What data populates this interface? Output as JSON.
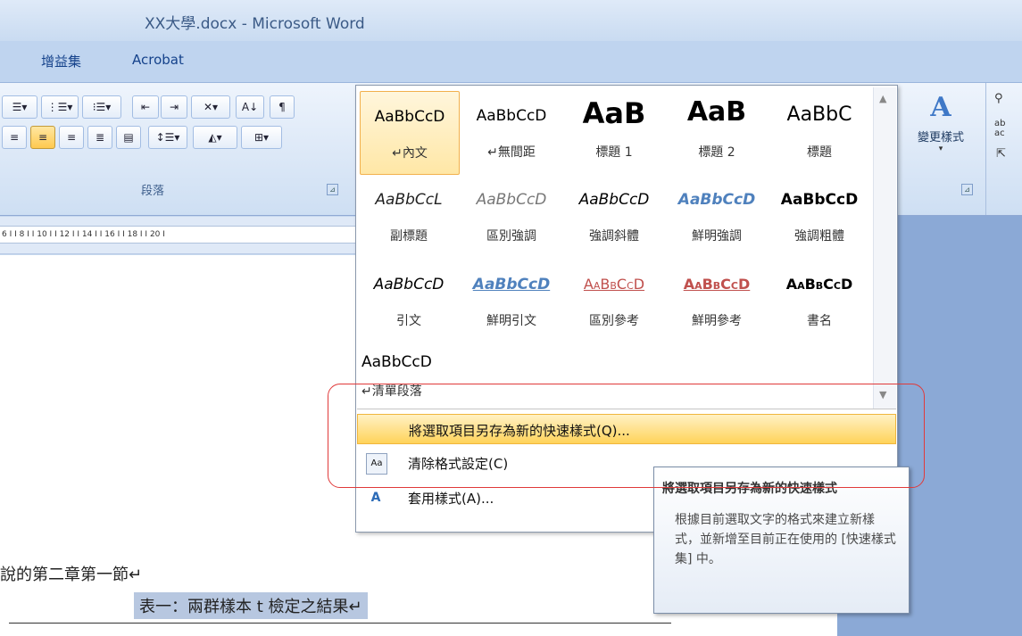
{
  "window": {
    "title": "XX大學.docx - Microsoft Word"
  },
  "tabs": [
    "增益集",
    "Acrobat"
  ],
  "ribbon": {
    "paragraph_group": {
      "label": "段落",
      "launcher": "⊿"
    },
    "styles_group": {
      "launcher": "⊿"
    },
    "change_styles": {
      "label": "變更樣式"
    },
    "editing_icons": [
      "尋找",
      "取代",
      "選取"
    ]
  },
  "ruler": {
    "text": "6 I  I 8 I  I 10 I  I 12 I  I 14 I  I 16 I  I 18 I  I 20 I"
  },
  "style_gallery": {
    "rows": [
      [
        {
          "preview": "AaBbCcD",
          "name": "↵內文",
          "selected": true
        },
        {
          "preview": "AaBbCcD",
          "name": "↵無間距"
        },
        {
          "preview": "AaB",
          "name": "標題 1"
        },
        {
          "preview": "AaB",
          "name": "標題 2"
        },
        {
          "preview": "AaBbC",
          "name": "標題"
        }
      ],
      [
        {
          "preview": "AaBbCcL",
          "name": "副標題"
        },
        {
          "preview": "AaBbCcD",
          "name": "區別強調"
        },
        {
          "preview": "AaBbCcD",
          "name": "強調斜體"
        },
        {
          "preview": "AaBbCcD",
          "name": "鮮明強調"
        },
        {
          "preview": "AaBbCcD",
          "name": "強調粗體"
        }
      ],
      [
        {
          "preview": "AaBbCcD",
          "name": "引文"
        },
        {
          "preview": "AaBbCcD",
          "name": "鮮明引文"
        },
        {
          "preview": "AaBbCcD",
          "name": "區別參考"
        },
        {
          "preview": "AaBbCcD",
          "name": "鮮明參考"
        },
        {
          "preview": "AaBbCcD",
          "name": "書名"
        }
      ],
      [
        {
          "preview": "AaBbCcD",
          "name": "↵清單段落"
        }
      ]
    ],
    "menu": [
      {
        "label": "將選取項目另存為新的快速樣式(Q)...",
        "highlighted": true
      },
      {
        "label": "清除格式設定(C)"
      },
      {
        "label": "套用樣式(A)..."
      }
    ]
  },
  "tooltip": {
    "title": "將選取項目另存為新的快速樣式",
    "body": "根據目前選取文字的格式來建立新樣式，並新增至目前正在使用的 [快速樣式集] 中。"
  },
  "document": {
    "line1": "說的第二章第一節↵",
    "line2": "表一：兩群樣本 t 檢定之結果↵"
  }
}
